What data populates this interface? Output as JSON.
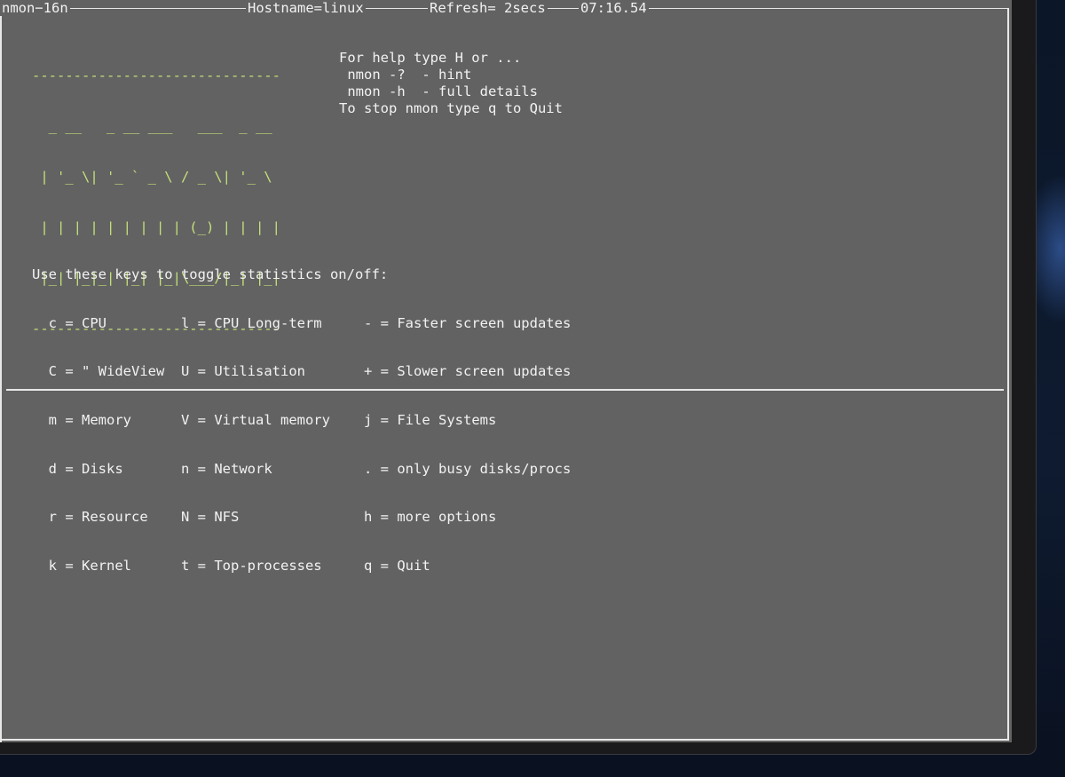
{
  "titlebar": {
    "program": "nmon−16n",
    "hostname": "Hostname=linux",
    "refresh": "Refresh= 2secs",
    "time": "07:16.54"
  },
  "logo": {
    "dashes_top": "------------------------------",
    "ascii_lines": [
      "  _ __   _ __ ___   ___  _ __",
      " | '_ \\| '_ ` _ \\ / _ \\| '_ \\",
      " | | | | | | | | | (_) | | | |",
      " |_| |_|_| |_| |_|\\___/|_| |_|"
    ],
    "dashes_bottom": "------------------------------"
  },
  "help": {
    "lines": [
      "For help type H or ...",
      " nmon -?  - hint",
      " nmon -h  - full details",
      "",
      "To stop nmon type q to Quit"
    ]
  },
  "keys": {
    "heading": "Use these keys to toggle statistics on/off:",
    "col1": [
      "  c = CPU",
      "  C = \" WideView",
      "  m = Memory",
      "  d = Disks",
      "  r = Resource",
      "  k = Kernel"
    ],
    "col2": [
      "l = CPU Long-term",
      "U = Utilisation",
      "V = Virtual memory",
      "n = Network",
      "N = NFS",
      "t = Top-processes"
    ],
    "col3": [
      "- = Faster screen updates",
      "+ = Slower screen updates",
      "j = File Systems",
      ". = only busy disks/procs",
      "h = more options",
      "q = Quit"
    ]
  }
}
